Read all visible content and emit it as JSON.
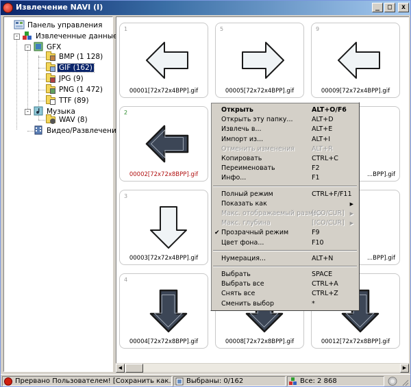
{
  "window": {
    "title": "Извлечение NAVI (I)",
    "min_glyph": "_",
    "max_glyph": "□",
    "close_glyph": "x"
  },
  "tree": {
    "control_panel": "Панель управления",
    "extracted": "Извлеченные данные",
    "gfx": "GFX",
    "bmp": "BMP (1 128)",
    "gif": "GIF (162)",
    "jpg": "JPG (9)",
    "png": "PNG (1 472)",
    "ttf": "TTF (89)",
    "music": "Музыка",
    "wav": "WAV (8)",
    "video": "Видео/Развлечения",
    "minus": "-"
  },
  "thumbs": [
    {
      "idx": "1",
      "caption": "00001[72x72x4BPP].gif",
      "arrow": "left",
      "style": "light"
    },
    {
      "idx": "5",
      "caption": "00005[72x72x4BPP].gif",
      "arrow": "right",
      "style": "light"
    },
    {
      "idx": "9",
      "caption": "00009[72x72x4BPP].gif",
      "arrow": "left",
      "style": "light"
    },
    {
      "idx": "2",
      "caption": "00002[72x72x8BPP].gif",
      "arrow": "left",
      "style": "dark"
    },
    {
      "idx": "",
      "caption": "",
      "arrow": "",
      "style": "hidden"
    },
    {
      "idx": "",
      "caption": "...BPP].gif",
      "arrow": "",
      "style": "partial"
    },
    {
      "idx": "3",
      "caption": "00003[72x72x4BPP].gif",
      "arrow": "down",
      "style": "light"
    },
    {
      "idx": "",
      "caption": "",
      "arrow": "",
      "style": "hidden"
    },
    {
      "idx": "",
      "caption": "...BPP].gif",
      "arrow": "",
      "style": "partial"
    },
    {
      "idx": "4",
      "caption": "00004[72x72x8BPP].gif",
      "arrow": "down",
      "style": "dark"
    },
    {
      "idx": "",
      "caption": "00008[72x72x8BPP].gif",
      "arrow": "down",
      "style": "dark"
    },
    {
      "idx": "",
      "caption": "00012[72x72x8BPP].gif",
      "arrow": "down",
      "style": "dark"
    }
  ],
  "menu": [
    {
      "label": "Открыть",
      "key": "ALT+O/F6",
      "bold": true
    },
    {
      "label": "Открыть эту папку...",
      "key": "ALT+D"
    },
    {
      "label": "Извлечь в...",
      "key": "ALT+E"
    },
    {
      "label": "Импорт из...",
      "key": "ALT+I"
    },
    {
      "label": "Отменить изменения",
      "key": "ALT+R",
      "disabled": true
    },
    {
      "label": "Копировать",
      "key": "CTRL+C"
    },
    {
      "label": "Переименовать",
      "key": "F2"
    },
    {
      "label": "Инфо...",
      "key": "F1"
    },
    {
      "sep": true
    },
    {
      "label": "Полный режим",
      "key": "CTRL+F/F11"
    },
    {
      "label": "Показать как",
      "key": "",
      "submenu": true
    },
    {
      "label": "Макс. отображаемый размер",
      "key": "[ICO/CUR]",
      "disabled": true,
      "submenu": true
    },
    {
      "label": "Макс. глубина",
      "key": "[ICO/CUR]",
      "disabled": true,
      "submenu": true
    },
    {
      "label": "Прозрачный режим",
      "key": "F9",
      "checked": true
    },
    {
      "label": "Цвет фона...",
      "key": "F10"
    },
    {
      "sep": true
    },
    {
      "label": "Нумерация...",
      "key": "ALT+N"
    },
    {
      "sep": true
    },
    {
      "label": "Выбрать",
      "key": "SPACE"
    },
    {
      "label": "Выбрать все",
      "key": "CTRL+A"
    },
    {
      "label": "Снять все",
      "key": "CTRL+Z"
    },
    {
      "label": "Сменить выбор",
      "key": "*"
    }
  ],
  "status": {
    "message": "Прервано Пользователем! [Сохранить как...] - сох",
    "selected": "Выбраны: 0/162",
    "total": "Все: 2 868"
  },
  "colors": {
    "title_start": "#0a246a",
    "title_end": "#a6caf0",
    "selection": "#0a246a",
    "arrow_light_fill": "#f0f4f6",
    "arrow_dark_fill": "#3c4656"
  }
}
